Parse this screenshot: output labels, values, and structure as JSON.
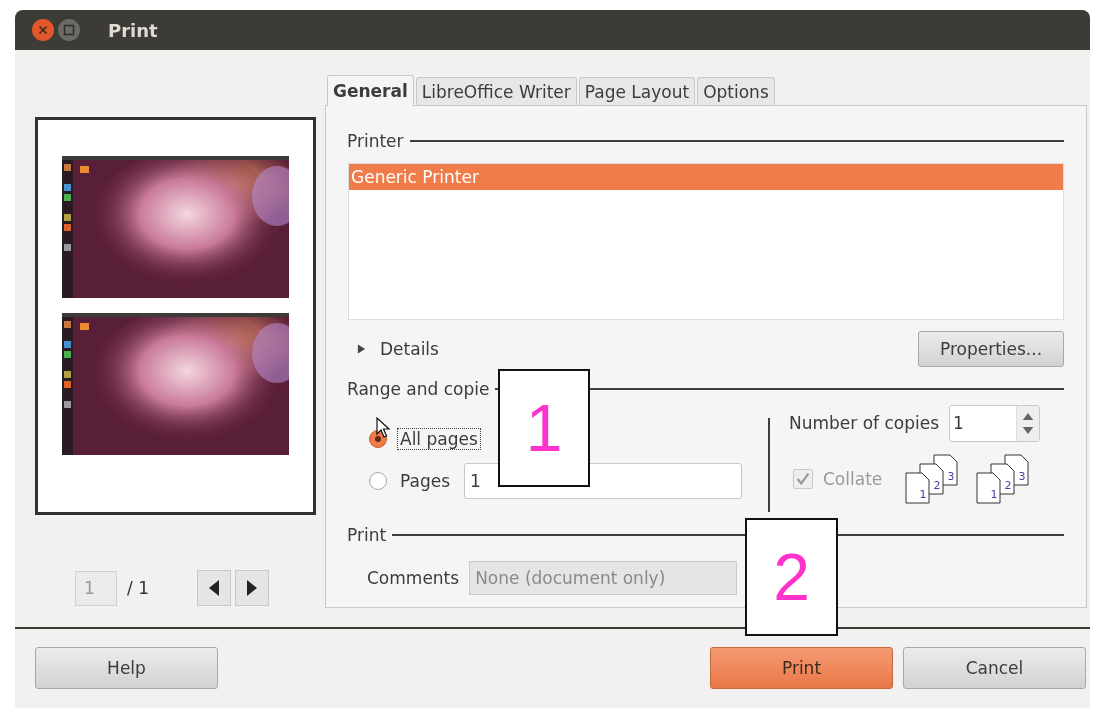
{
  "window": {
    "title": "Print"
  },
  "preview": {
    "page_field": "1",
    "page_total": "/ 1"
  },
  "tabs": [
    {
      "label": "General",
      "selected": true
    },
    {
      "label": "LibreOffice Writer",
      "selected": false
    },
    {
      "label": "Page Layout",
      "selected": false
    },
    {
      "label": "Options",
      "selected": false
    }
  ],
  "printer": {
    "heading": "Printer",
    "printers": [
      {
        "name": "Generic Printer",
        "selected": true
      }
    ],
    "details": "Details",
    "details_expanded": false,
    "properties_button": "Properties..."
  },
  "range": {
    "heading": "Range and copie",
    "options": [
      {
        "label": "All pages",
        "selected": true
      },
      {
        "label": "Pages",
        "selected": false,
        "value": "1"
      }
    ],
    "copies_label": "Number of copies",
    "copies_value": "1",
    "collate": {
      "label": "Collate",
      "checked": true,
      "disabled": true
    },
    "collate_icons": [
      {
        "pages": [
          "1",
          "2",
          "3"
        ]
      },
      {
        "pages": [
          "1",
          "2",
          "3"
        ]
      }
    ]
  },
  "print": {
    "heading": "Print",
    "comments_label": "Comments",
    "comments_value": "None (document only)"
  },
  "buttons": [
    {
      "label": "Help",
      "kind": "normal"
    },
    {
      "label": "Print",
      "kind": "default"
    },
    {
      "label": "Cancel",
      "kind": "normal"
    }
  ],
  "callouts": [
    "1",
    "2"
  ]
}
